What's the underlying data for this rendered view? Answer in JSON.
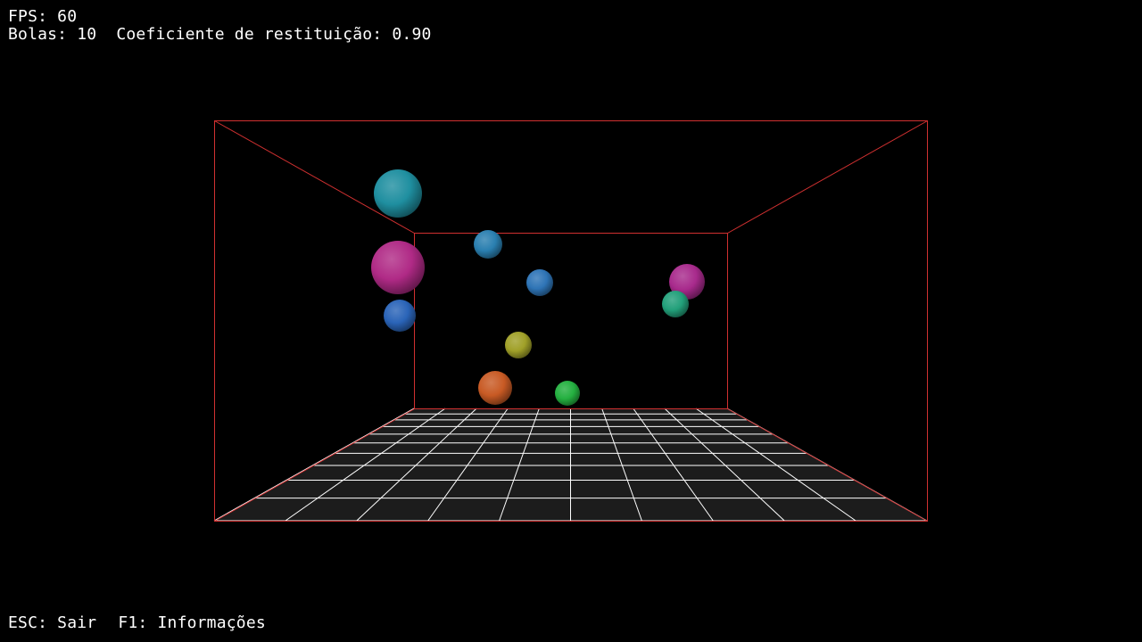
{
  "hud": {
    "fps_label": "FPS: 60",
    "balls_label": "Bolas: 10",
    "restitution_label": "Coeficiente de restituição: 0.90",
    "exit_hint": "ESC: Sair",
    "info_hint": "F1: Informações"
  },
  "colors": {
    "background": "#000000",
    "box_edges": "#d03030",
    "floor_fill": "#1c1c1c",
    "grid_lines": "#ffffff",
    "hud_text": "#ffffff"
  },
  "balls": [
    {
      "name": "ball-teal-large",
      "color": "#1f8fa0"
    },
    {
      "name": "ball-steelblue-small",
      "color": "#2a7fb0"
    },
    {
      "name": "ball-magenta-large",
      "color": "#b02a86"
    },
    {
      "name": "ball-blue",
      "color": "#2a64b8"
    },
    {
      "name": "ball-blue-small",
      "color": "#2e74b6"
    },
    {
      "name": "ball-magenta-right",
      "color": "#a82a8c"
    },
    {
      "name": "ball-teal-green",
      "color": "#22a07a"
    },
    {
      "name": "ball-yellow",
      "color": "#a0a028"
    },
    {
      "name": "ball-orange",
      "color": "#c85a24"
    },
    {
      "name": "ball-green",
      "color": "#24b040"
    }
  ]
}
